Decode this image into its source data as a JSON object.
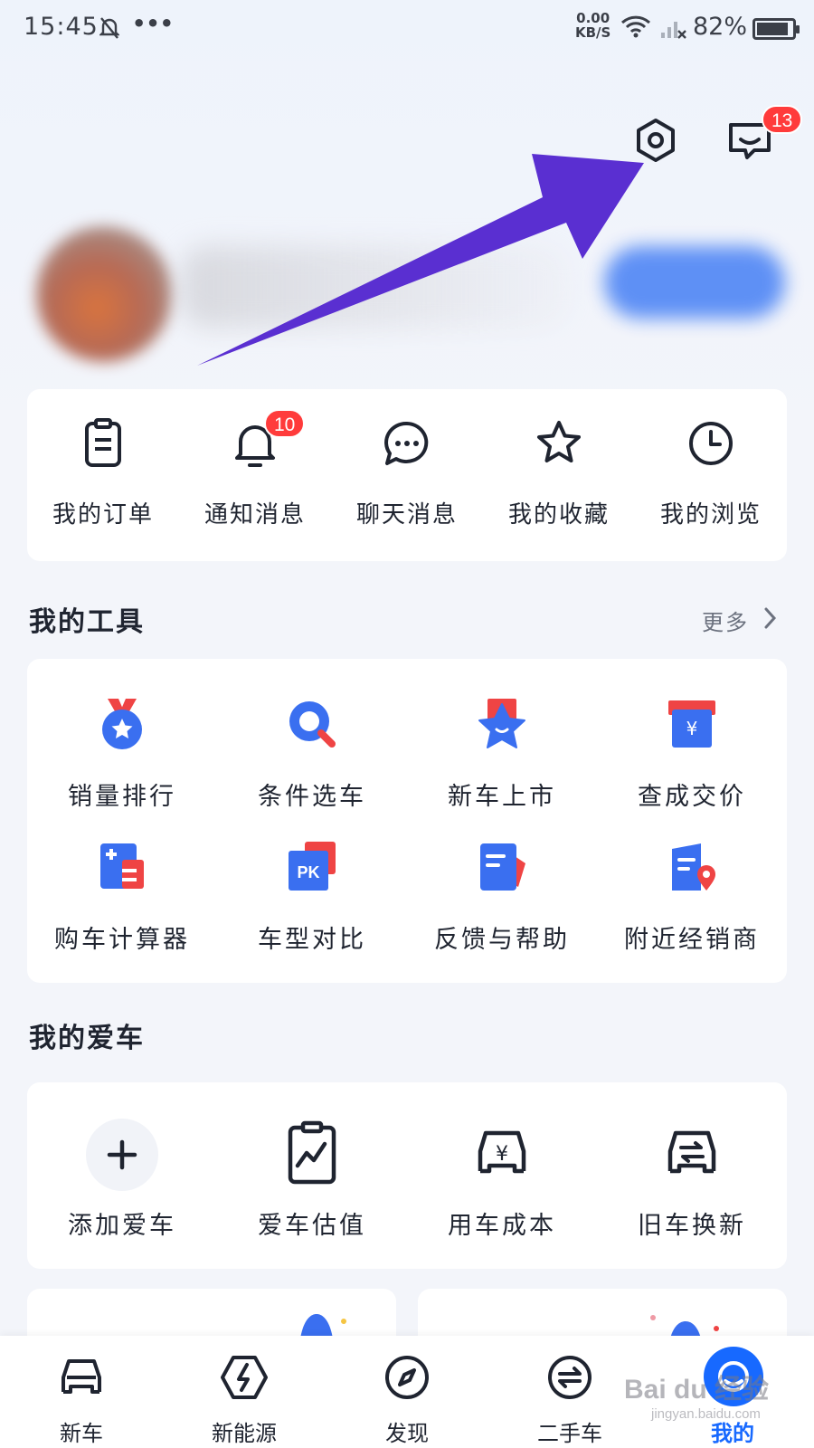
{
  "status_bar": {
    "time": "15:45",
    "dots": "•••",
    "net_speed_value": "0.00",
    "net_speed_unit": "KB/S",
    "battery": "82%"
  },
  "header": {
    "message_badge": "13",
    "settings_icon": "settings-hex-icon",
    "message_icon": "chat-icon"
  },
  "quick_actions": [
    {
      "label": "我的订单",
      "icon": "order-icon"
    },
    {
      "label": "通知消息",
      "icon": "bell-icon",
      "badge": "10"
    },
    {
      "label": "聊天消息",
      "icon": "chat-bubble-icon"
    },
    {
      "label": "我的收藏",
      "icon": "star-icon"
    },
    {
      "label": "我的浏览",
      "icon": "clock-icon"
    }
  ],
  "tools": {
    "title": "我的工具",
    "more": "更多",
    "items": [
      {
        "label": "销量排行",
        "icon": "medal-icon"
      },
      {
        "label": "条件选车",
        "icon": "search-icon"
      },
      {
        "label": "新车上市",
        "icon": "new-car-star-icon"
      },
      {
        "label": "查成交价",
        "icon": "price-icon"
      },
      {
        "label": "购车计算器",
        "icon": "calculator-icon"
      },
      {
        "label": "车型对比",
        "icon": "pk-icon"
      },
      {
        "label": "反馈与帮助",
        "icon": "feedback-icon"
      },
      {
        "label": "附近经销商",
        "icon": "dealer-location-icon"
      }
    ]
  },
  "my_car": {
    "title": "我的爱车",
    "items": [
      {
        "label": "添加爱车",
        "icon": "plus-icon"
      },
      {
        "label": "爱车估值",
        "icon": "valuation-chart-icon"
      },
      {
        "label": "用车成本",
        "icon": "car-cost-icon"
      },
      {
        "label": "旧车换新",
        "icon": "car-trade-icon"
      }
    ]
  },
  "tabbar": [
    {
      "label": "新车",
      "icon": "car-icon"
    },
    {
      "label": "新能源",
      "icon": "lightning-icon"
    },
    {
      "label": "发现",
      "icon": "compass-icon"
    },
    {
      "label": "二手车",
      "icon": "exchange-icon"
    },
    {
      "label": "我的",
      "icon": "profile-icon",
      "active": true
    }
  ],
  "watermark": {
    "text": "Bai du 经验",
    "sub": "jingyan.baidu.com"
  },
  "colors": {
    "accent": "#1769ff",
    "badge": "#ff3b3b",
    "arrow": "#5a2fd1",
    "text": "#1f2430"
  }
}
